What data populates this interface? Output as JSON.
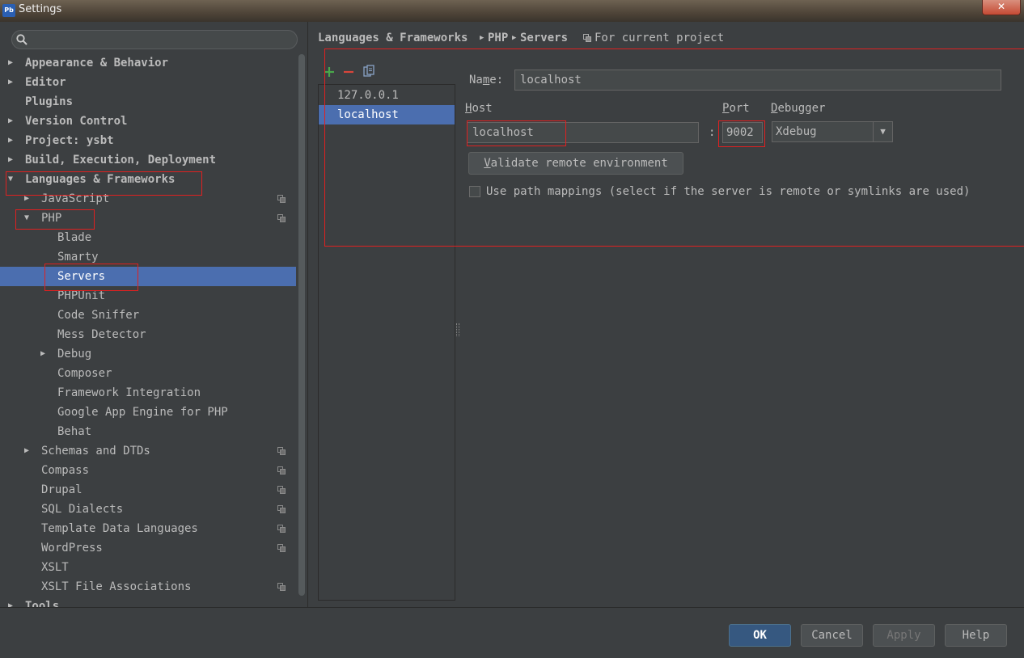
{
  "window": {
    "title": "Settings",
    "app_icon": "Pb",
    "close_label": "✕"
  },
  "search": {
    "placeholder": ""
  },
  "tree": [
    {
      "label": "Appearance & Behavior",
      "level": 0,
      "arrow": "▶",
      "project_icon": false
    },
    {
      "label": "Editor",
      "level": 0,
      "arrow": "▶",
      "project_icon": false
    },
    {
      "label": "Plugins",
      "level": 0,
      "arrow": "",
      "project_icon": false
    },
    {
      "label": "Version Control",
      "level": 0,
      "arrow": "▶",
      "project_icon": false
    },
    {
      "label": "Project: ysbt",
      "level": 0,
      "arrow": "▶",
      "project_icon": false
    },
    {
      "label": "Build, Execution, Deployment",
      "level": 0,
      "arrow": "▶",
      "project_icon": false
    },
    {
      "label": "Languages & Frameworks",
      "level": 0,
      "arrow": "▼",
      "project_icon": false
    },
    {
      "label": "JavaScript",
      "level": 1,
      "arrow": "▶",
      "project_icon": true
    },
    {
      "label": "PHP",
      "level": 1,
      "arrow": "▼",
      "project_icon": true
    },
    {
      "label": "Blade",
      "level": 2,
      "arrow": "",
      "project_icon": false
    },
    {
      "label": "Smarty",
      "level": 2,
      "arrow": "",
      "project_icon": false
    },
    {
      "label": "Servers",
      "level": 2,
      "arrow": "",
      "project_icon": false,
      "selected": true
    },
    {
      "label": "PHPUnit",
      "level": 2,
      "arrow": "",
      "project_icon": false
    },
    {
      "label": "Code Sniffer",
      "level": 2,
      "arrow": "",
      "project_icon": false
    },
    {
      "label": "Mess Detector",
      "level": 2,
      "arrow": "",
      "project_icon": false
    },
    {
      "label": "Debug",
      "level": 2,
      "arrow": "▶",
      "project_icon": false
    },
    {
      "label": "Composer",
      "level": 2,
      "arrow": "",
      "project_icon": false
    },
    {
      "label": "Framework Integration",
      "level": 2,
      "arrow": "",
      "project_icon": false
    },
    {
      "label": "Google App Engine for PHP",
      "level": 2,
      "arrow": "",
      "project_icon": false
    },
    {
      "label": "Behat",
      "level": 2,
      "arrow": "",
      "project_icon": false
    },
    {
      "label": "Schemas and DTDs",
      "level": 1,
      "arrow": "▶",
      "project_icon": true
    },
    {
      "label": "Compass",
      "level": 1,
      "arrow": "",
      "project_icon": true
    },
    {
      "label": "Drupal",
      "level": 1,
      "arrow": "",
      "project_icon": true
    },
    {
      "label": "SQL Dialects",
      "level": 1,
      "arrow": "",
      "project_icon": true
    },
    {
      "label": "Template Data Languages",
      "level": 1,
      "arrow": "",
      "project_icon": true
    },
    {
      "label": "WordPress",
      "level": 1,
      "arrow": "",
      "project_icon": true
    },
    {
      "label": "XSLT",
      "level": 1,
      "arrow": "",
      "project_icon": false
    },
    {
      "label": "XSLT File Associations",
      "level": 1,
      "arrow": "",
      "project_icon": true
    },
    {
      "label": "Tools",
      "level": 0,
      "arrow": "▶",
      "project_icon": false
    }
  ],
  "breadcrumb": {
    "parts": [
      "Languages & Frameworks",
      "PHP",
      "Servers"
    ],
    "separator": "▶",
    "scope": "For current project"
  },
  "servers": {
    "list": [
      "127.0.0.1",
      "localhost"
    ],
    "selected": "localhost"
  },
  "form": {
    "name_label_pre": "Na",
    "name_label_u": "m",
    "name_label_post": "e:",
    "name_value": "localhost",
    "host_label_u": "H",
    "host_label_post": "ost",
    "host_value": "localhost",
    "colon": ":",
    "port_label_u": "P",
    "port_label_post": "ort",
    "port_value": "9002",
    "debugger_label_u": "D",
    "debugger_label_post": "ebugger",
    "debugger_value": "Xdebug",
    "validate_u": "V",
    "validate_post": "alidate remote environment",
    "path_mappings": "Use path mappings (select if the server is remote or symlinks are used)",
    "path_mappings_checked": false
  },
  "buttons": {
    "ok": "OK",
    "cancel": "Cancel",
    "apply": "Apply",
    "help": "Help"
  },
  "colors": {
    "selection": "#4b6eaf",
    "highlight_box": "#e02020",
    "add_icon": "#49a84b",
    "remove_icon": "#d9453b"
  }
}
